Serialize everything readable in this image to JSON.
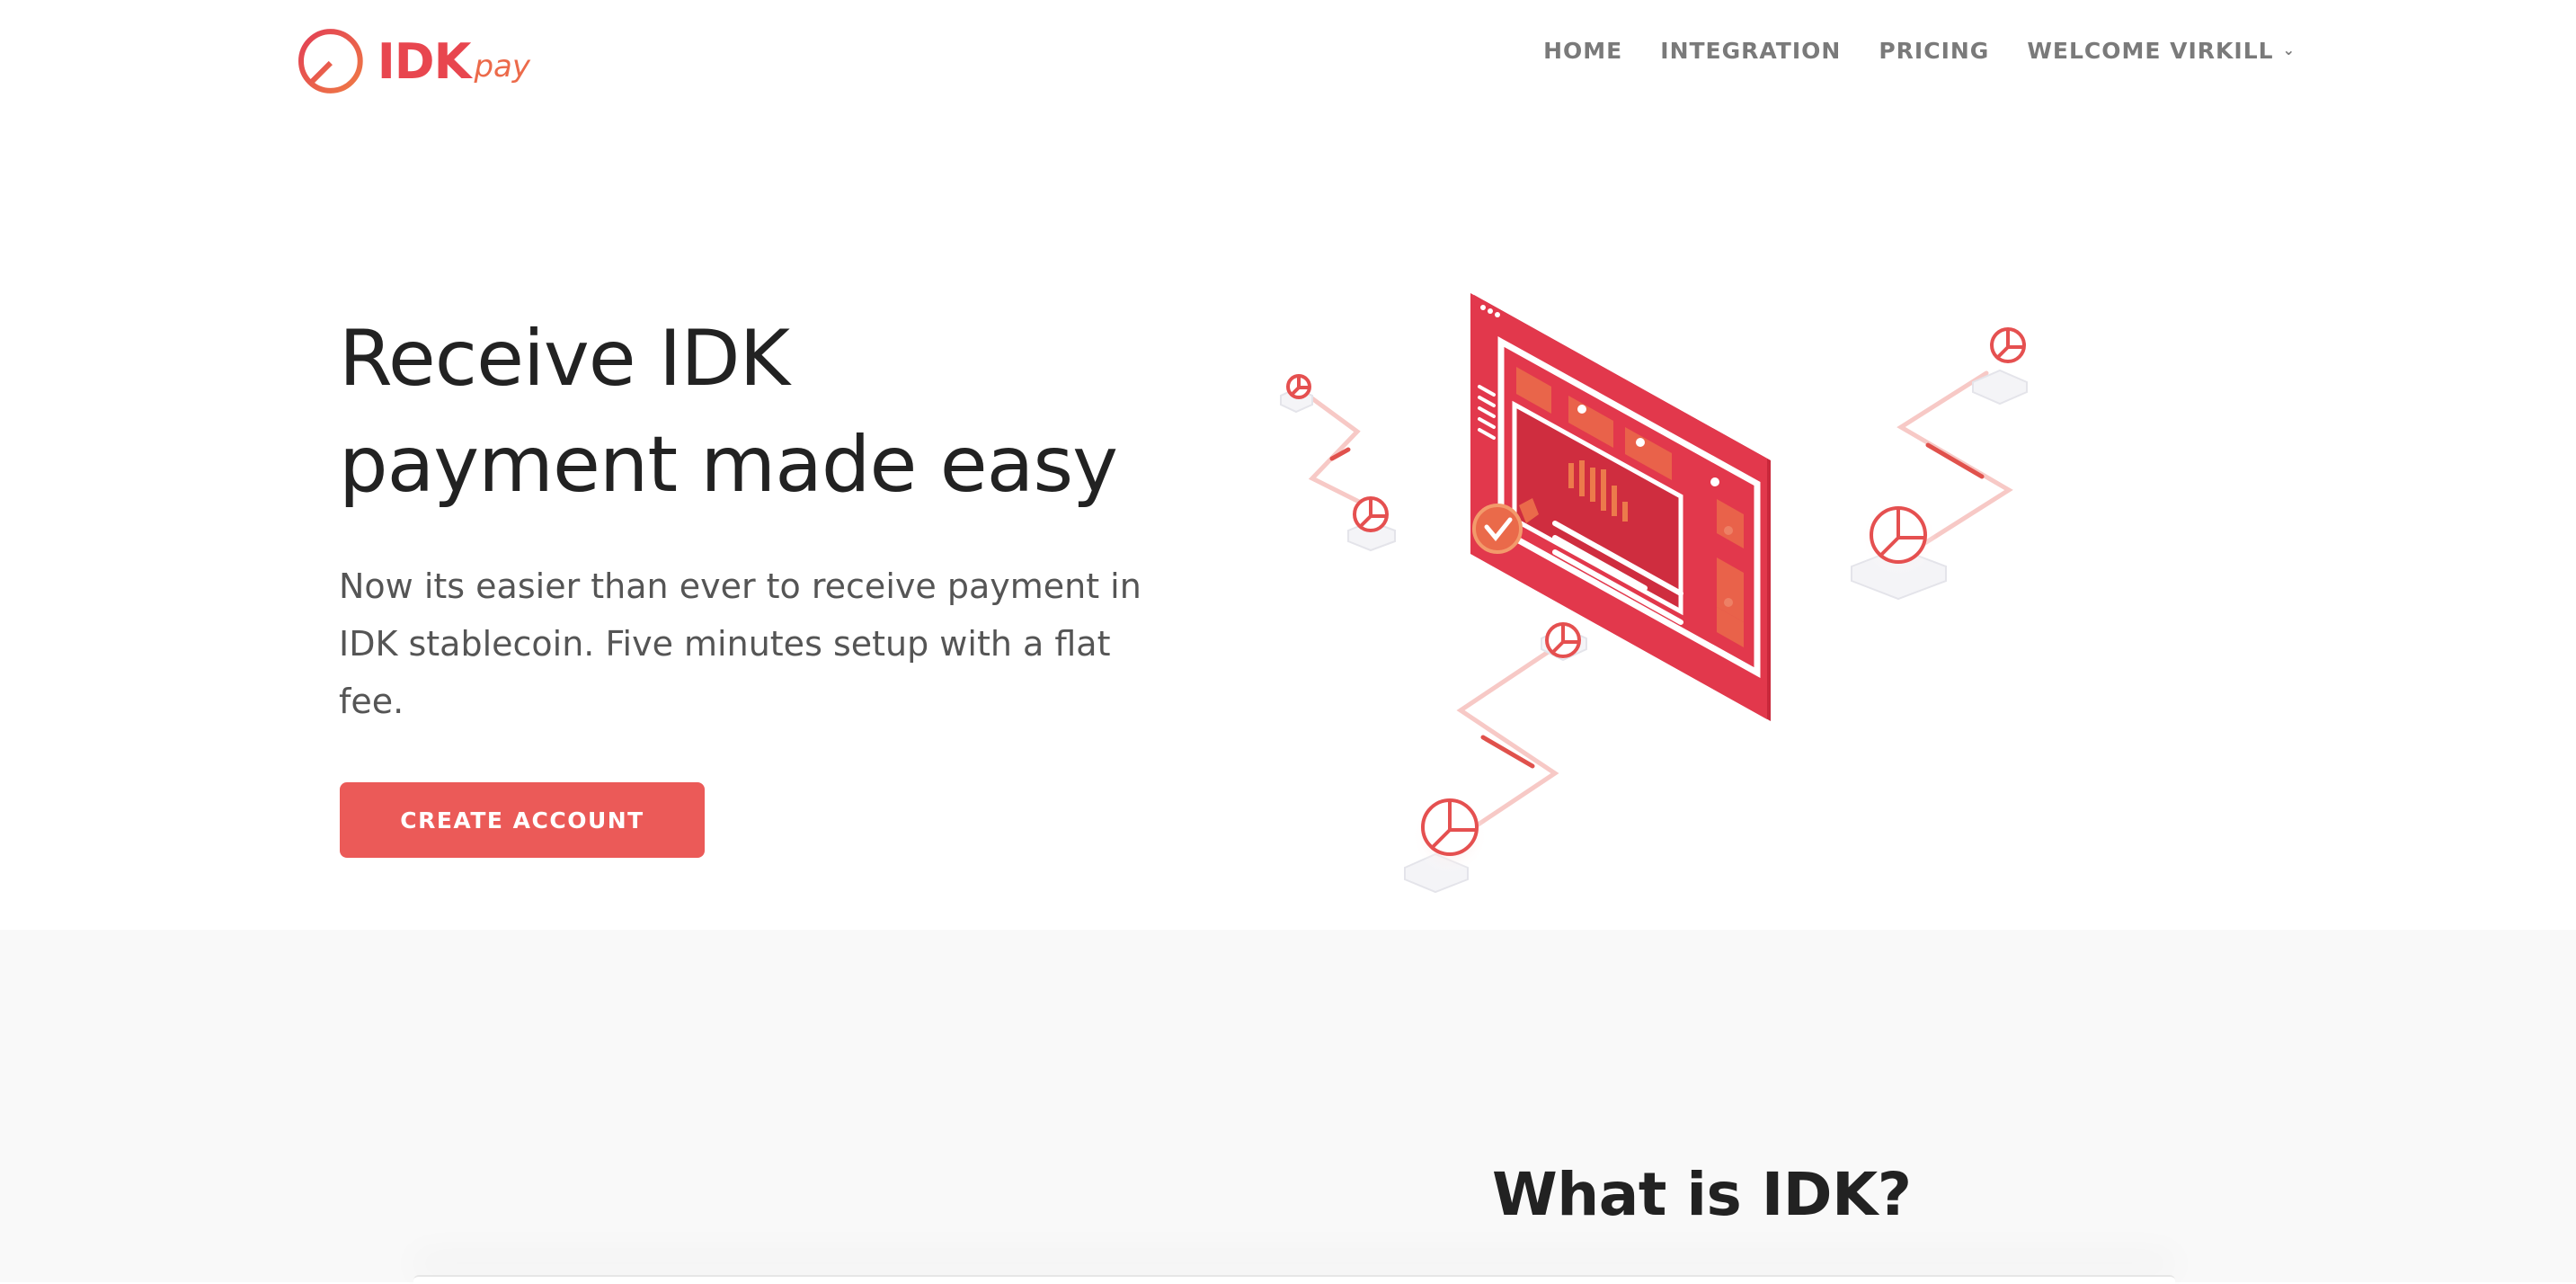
{
  "brand": {
    "name": "IDK",
    "suffix": "pay",
    "colors": {
      "primary": "#e8464f",
      "accent": "#ec6a4a",
      "button": "#eb5a58"
    }
  },
  "nav": {
    "items": [
      {
        "label": "HOME"
      },
      {
        "label": "INTEGRATION"
      },
      {
        "label": "PRICING"
      },
      {
        "label": "WELCOME VIRKILL",
        "icon": "chevron-down-icon"
      }
    ]
  },
  "hero": {
    "title_line1": "Receive IDK",
    "title_line2": "payment made easy",
    "subtitle": "Now its easier than ever to receive payment in IDK stablecoin. Five minutes setup with a flat fee.",
    "cta_label": "CREATE ACCOUNT"
  },
  "section2": {
    "title": "What is IDK?"
  }
}
